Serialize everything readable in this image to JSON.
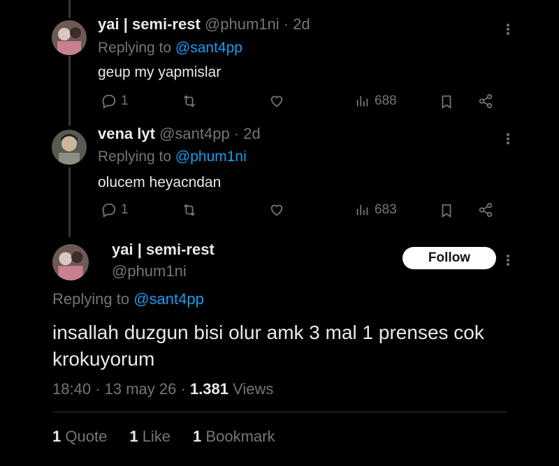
{
  "replies": [
    {
      "display_name": "yai | semi-rest",
      "handle": "@phum1ni",
      "dot": "·",
      "age": "2d",
      "replying_prefix": "Replying to",
      "replying_to": "@sant4pp",
      "text": "geup my yapmislar",
      "reply_count": "1",
      "views": "688"
    },
    {
      "display_name": "vena lyt",
      "handle": "@sant4pp",
      "dot": "·",
      "age": "2d",
      "replying_prefix": "Replying to",
      "replying_to": "@phum1ni",
      "text": "olucem heyacndan",
      "reply_count": "1",
      "views": "683"
    }
  ],
  "main": {
    "display_name": "yai | semi-rest",
    "handle": "@phum1ni",
    "follow_label": "Follow",
    "replying_prefix": "Replying to",
    "replying_to": "@sant4pp",
    "text": "insallah duzgun bisi olur amk 3 mal 1 prenses cok krokuyorum",
    "time": "18:40",
    "date": "13 may 26",
    "views_count": "1.381",
    "views_label": "Views",
    "sep": "·",
    "quotes_count": "1",
    "quotes_label": "Quote",
    "likes_count": "1",
    "likes_label": "Like",
    "bookmarks_count": "1",
    "bookmarks_label": "Bookmark"
  },
  "icons": [
    "reply-icon",
    "retweet-icon",
    "like-icon",
    "views-icon",
    "bookmark-icon",
    "share-icon",
    "more-icon"
  ],
  "colors": {
    "background": "#000000",
    "text": "#e7e9ea",
    "muted": "#71767b",
    "link": "#1d9bf0",
    "follow_bg": "#ffffff"
  }
}
